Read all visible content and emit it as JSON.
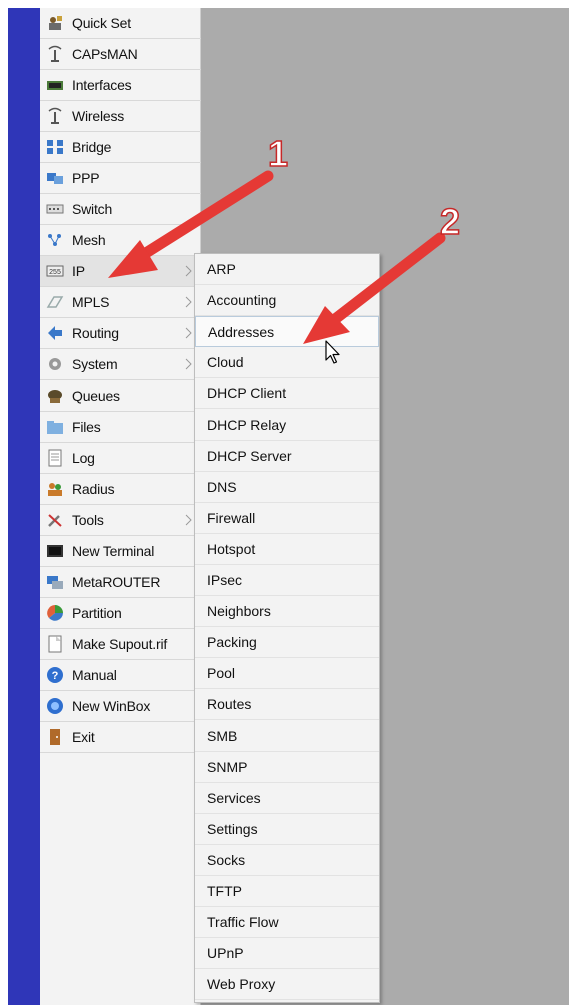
{
  "colors": {
    "left_bar": "#2f36b8",
    "workspace": "#ababab",
    "menu_bg": "#f3f3f3",
    "annotation_red": "#e53935"
  },
  "main_menu": {
    "items": [
      {
        "label": "Quick Set",
        "icon": "quickset-icon",
        "submenu": false
      },
      {
        "label": "CAPsMAN",
        "icon": "capsman-icon",
        "submenu": false
      },
      {
        "label": "Interfaces",
        "icon": "interfaces-icon",
        "submenu": false
      },
      {
        "label": "Wireless",
        "icon": "wireless-icon",
        "submenu": false
      },
      {
        "label": "Bridge",
        "icon": "bridge-icon",
        "submenu": false
      },
      {
        "label": "PPP",
        "icon": "ppp-icon",
        "submenu": false
      },
      {
        "label": "Switch",
        "icon": "switch-icon",
        "submenu": false
      },
      {
        "label": "Mesh",
        "icon": "mesh-icon",
        "submenu": false
      },
      {
        "label": "IP",
        "icon": "ip-icon",
        "submenu": true
      },
      {
        "label": "MPLS",
        "icon": "mpls-icon",
        "submenu": true
      },
      {
        "label": "Routing",
        "icon": "routing-icon",
        "submenu": true
      },
      {
        "label": "System",
        "icon": "system-gear-icon",
        "submenu": true
      },
      {
        "label": "Queues",
        "icon": "queues-icon",
        "submenu": false
      },
      {
        "label": "Files",
        "icon": "folder-icon",
        "submenu": false
      },
      {
        "label": "Log",
        "icon": "log-icon",
        "submenu": false
      },
      {
        "label": "Radius",
        "icon": "radius-icon",
        "submenu": false
      },
      {
        "label": "Tools",
        "icon": "tools-icon",
        "submenu": true
      },
      {
        "label": "New Terminal",
        "icon": "terminal-icon",
        "submenu": false
      },
      {
        "label": "MetaROUTER",
        "icon": "metarouter-icon",
        "submenu": false
      },
      {
        "label": "Partition",
        "icon": "partition-icon",
        "submenu": false
      },
      {
        "label": "Make Supout.rif",
        "icon": "supout-file-icon",
        "submenu": false
      },
      {
        "label": "Manual",
        "icon": "help-icon",
        "submenu": false
      },
      {
        "label": "New WinBox",
        "icon": "winbox-icon",
        "submenu": false
      },
      {
        "label": "Exit",
        "icon": "exit-door-icon",
        "submenu": false
      }
    ],
    "active_item": "IP"
  },
  "ip_submenu": {
    "items": [
      "ARP",
      "Accounting",
      "Addresses",
      "Cloud",
      "DHCP Client",
      "DHCP Relay",
      "DHCP Server",
      "DNS",
      "Firewall",
      "Hotspot",
      "IPsec",
      "Neighbors",
      "Packing",
      "Pool",
      "Routes",
      "SMB",
      "SNMP",
      "Services",
      "Settings",
      "Socks",
      "TFTP",
      "Traffic Flow",
      "UPnP",
      "Web Proxy"
    ],
    "hovered_item": "Addresses"
  },
  "annotations": [
    {
      "number": "1",
      "target": "IP"
    },
    {
      "number": "2",
      "target": "Addresses"
    }
  ]
}
